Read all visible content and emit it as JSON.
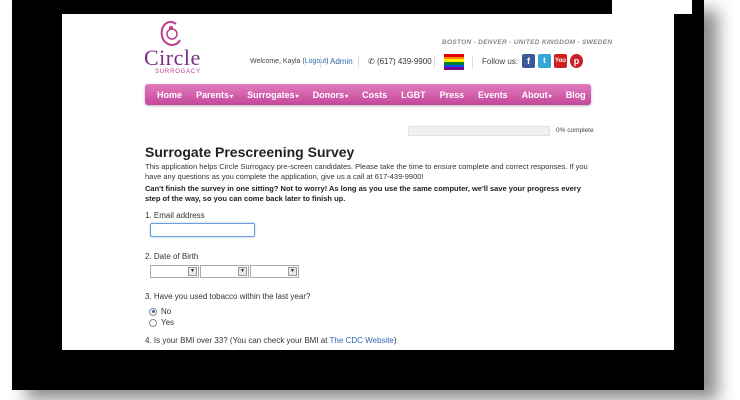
{
  "header": {
    "logo_word": "Circle",
    "logo_sub": "SURROGACY",
    "cities": "BOSTON - DENVER - UNITED KINGDOM - SWEDEN",
    "welcome_prefix": "Welcome, Kayla (",
    "logout_label": "Logout",
    "welcome_suffix": ")",
    "admin_label": "Admin",
    "phone": "(617) 439-9900",
    "follow_label": "Follow us:",
    "social": [
      "facebook-icon",
      "twitter-icon",
      "youtube-icon",
      "pinterest-icon"
    ],
    "social_colors": [
      "#3b5998",
      "#33a5d8",
      "#cc2222",
      "#cb2027"
    ]
  },
  "nav": [
    {
      "label": "Home"
    },
    {
      "label": "Parents",
      "caret": "▾"
    },
    {
      "label": "Surrogates",
      "caret": "▾"
    },
    {
      "label": "Donors",
      "caret": "▾"
    },
    {
      "label": "Costs"
    },
    {
      "label": "LGBT"
    },
    {
      "label": "Press"
    },
    {
      "label": "Events"
    },
    {
      "label": "About",
      "caret": "▾"
    },
    {
      "label": "Blog"
    }
  ],
  "progress": {
    "value": 0,
    "label": "0% complete"
  },
  "survey": {
    "title": "Surrogate Prescreening Survey",
    "intro": "This application helps Circle Surrogacy pre-screen candidates. Please take the time to ensure complete and correct responses. If you have any questions as you complete the application, give us a call at 617-439-9900!",
    "note": "Can't finish the survey in one sitting? Not to worry! As long as you use the same computer, we'll save your progress every step of the way, so you can come back later to finish up.",
    "q1": "1. Email address",
    "email_value": "",
    "q2": "2. Date of Birth",
    "q3": "3. Have you used tobacco within the last year?",
    "q3_options": [
      "No",
      "Yes"
    ],
    "q3_selected": "No",
    "q4_prefix": "4. Is your BMI over 33? (You can check your BMI at ",
    "q4_link": "The CDC Website",
    "q4_suffix": ")"
  },
  "colors": {
    "accent": "#c4479a",
    "link": "#2d6ab0",
    "brand": "#7a2e86"
  }
}
